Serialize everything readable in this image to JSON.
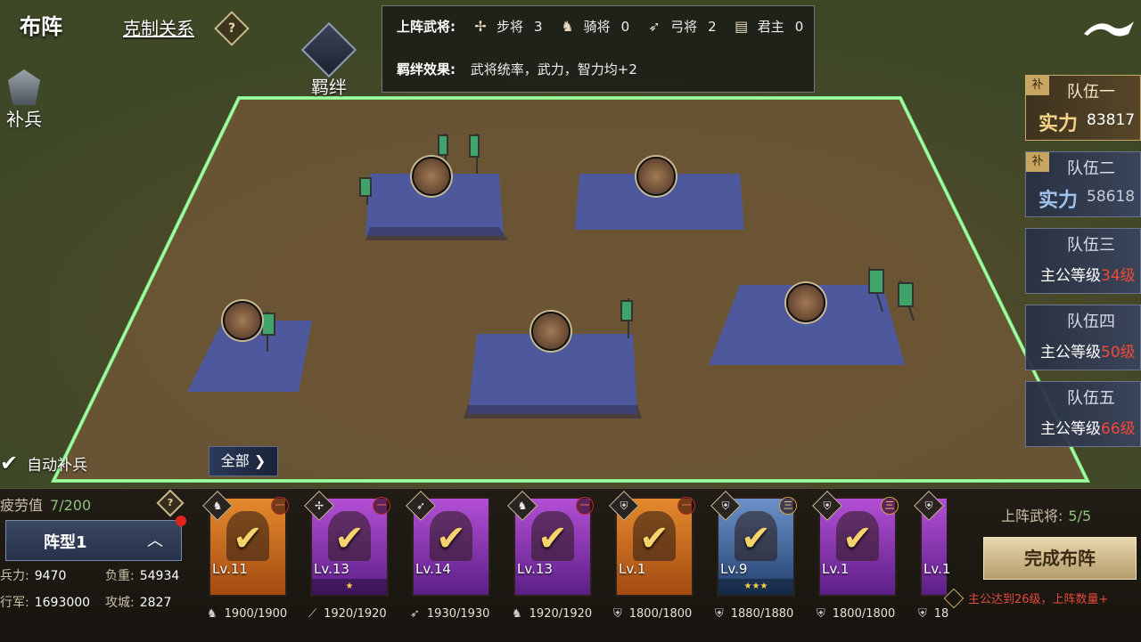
{
  "header": {
    "title": "布阵",
    "counter_link": "克制关系",
    "help_glyph": "?",
    "bond_label": "羁绊",
    "reinforce_label": "补兵"
  },
  "info_panel": {
    "deployed_label": "上阵武将:",
    "types": [
      {
        "icon": "infantry-icon",
        "label": "步将",
        "count": "3"
      },
      {
        "icon": "cavalry-icon",
        "label": "骑将",
        "count": "0"
      },
      {
        "icon": "archer-icon",
        "label": "弓将",
        "count": "2"
      },
      {
        "icon": "lord-icon",
        "label": "君主",
        "count": "0"
      }
    ],
    "bond_effect_label": "羁绊效果:",
    "bond_effect_text": "武将统率，武力，智力均+2"
  },
  "teams": [
    {
      "name": "队伍一",
      "tag": "补",
      "power_label": "实力",
      "power": "83817",
      "active": true
    },
    {
      "name": "队伍二",
      "tag": "补",
      "power_label": "实力",
      "power": "58618",
      "active": false
    },
    {
      "name": "队伍三",
      "lock_text": "主公等级",
      "lock_level": "34级"
    },
    {
      "name": "队伍四",
      "lock_text": "主公等级",
      "lock_level": "50级"
    },
    {
      "name": "队伍五",
      "lock_text": "主公等级",
      "lock_level": "66级"
    }
  ],
  "controls": {
    "auto_supply": "自动补兵",
    "all_button": "全部",
    "fatigue_label": "疲劳值",
    "fatigue_value": "7/200",
    "formation_label": "阵型1",
    "stats": {
      "force_label": "兵力:",
      "force": "9470",
      "load_label": "负重:",
      "load": "54934",
      "march_label": "行军:",
      "march": "1693000",
      "siege_label": "攻城:",
      "siege": "2827"
    }
  },
  "cards": [
    {
      "level": "Lv.11",
      "color": "orange",
      "stars": "",
      "troops": "1900/1900",
      "troop_icon": "horse-icon",
      "badge": "一"
    },
    {
      "level": "Lv.13",
      "color": "purple",
      "stars": "★",
      "troops": "1920/1920",
      "troop_icon": "spear-icon",
      "badge": "一"
    },
    {
      "level": "Lv.14",
      "color": "purple",
      "stars": "",
      "troops": "1930/1930",
      "troop_icon": "bow-icon",
      "badge": ""
    },
    {
      "level": "Lv.13",
      "color": "purple",
      "stars": "",
      "troops": "1920/1920",
      "troop_icon": "horse-icon",
      "badge": "一"
    },
    {
      "level": "Lv.1",
      "color": "orange",
      "stars": "",
      "troops": "1800/1800",
      "troop_icon": "shield-icon",
      "badge": "一"
    },
    {
      "level": "Lv.9",
      "color": "blue",
      "stars": "★★★",
      "troops": "1880/1880",
      "troop_icon": "shield-icon",
      "badge": "三"
    },
    {
      "level": "Lv.1",
      "color": "purple",
      "stars": "",
      "troops": "1800/1800",
      "troop_icon": "shield-icon",
      "badge": "三"
    },
    {
      "level": "Lv.1",
      "color": "purple",
      "stars": "",
      "troops": "18",
      "troop_icon": "shield-icon",
      "badge": ""
    }
  ],
  "deploy": {
    "label": "上阵武将:",
    "value": "5/5",
    "done_button": "完成布阵",
    "notice": "主公达到26级，上阵数量+"
  }
}
